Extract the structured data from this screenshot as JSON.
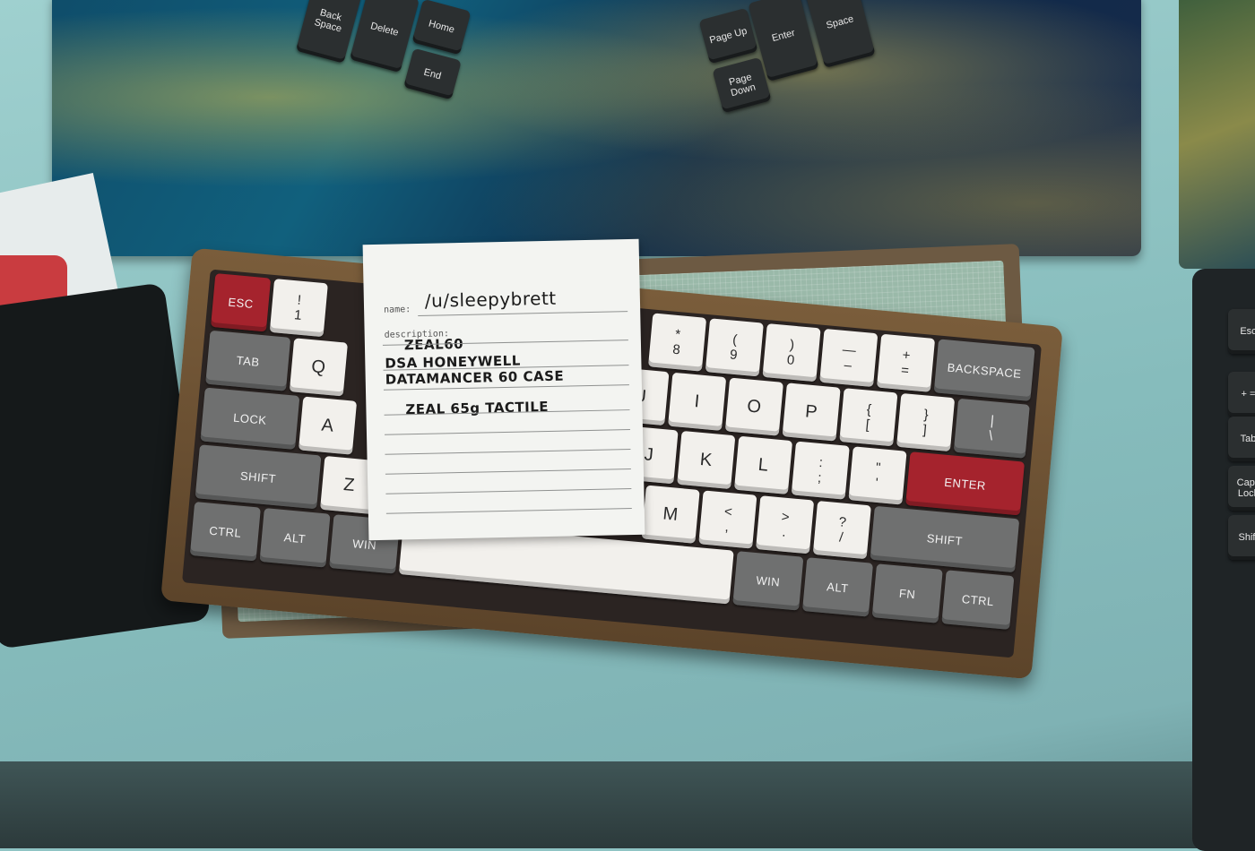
{
  "scene": {
    "description_card": {
      "name_label": "name:",
      "name_value": "/u/sleepybrett",
      "description_label": "description:",
      "lines": [
        "ZEAL60",
        "DSA HONEYWELL",
        "DATAMANCER 60 CASE",
        "ZEAL 65g TACTILE"
      ]
    },
    "ergo_keyboard_left": {
      "keys": [
        "Back Space",
        "Delete",
        "Home",
        "End"
      ]
    },
    "ergo_keyboard_right": {
      "keys": [
        "Page Up",
        "Enter",
        "Space",
        "Page Down"
      ]
    },
    "side_keyboard": {
      "keys": [
        "Esc",
        "+ =",
        "Tab",
        "Caps Lock",
        "Shift"
      ]
    },
    "keyboard": {
      "row1": [
        "ESC",
        "!\n1",
        "*\n8",
        "(\n9",
        ")\n0",
        "—\n–",
        "+\n=",
        "BACKSPACE"
      ],
      "row2": [
        "TAB",
        "Q",
        "U",
        "I",
        "O",
        "P",
        "{\n[",
        "}\n]",
        "|\n\\"
      ],
      "row3": [
        "LOCK",
        "A",
        "J",
        "K",
        "L",
        ":\n;",
        "\"\n'",
        "ENTER"
      ],
      "row4": [
        "SHIFT",
        "Z",
        "M",
        "<\n,",
        ">\n.",
        "?\n/",
        "SHIFT"
      ],
      "row5": [
        "CTRL",
        "ALT",
        "WIN",
        "WIN",
        "ALT",
        "FN",
        "CTRL"
      ]
    },
    "colors": {
      "desk": "#8fc4c4",
      "wood": "#6d5a43",
      "accent_red": "#a5232d",
      "modifier_gray": "#6f7070",
      "alpha_white": "#f2f0ec"
    }
  }
}
